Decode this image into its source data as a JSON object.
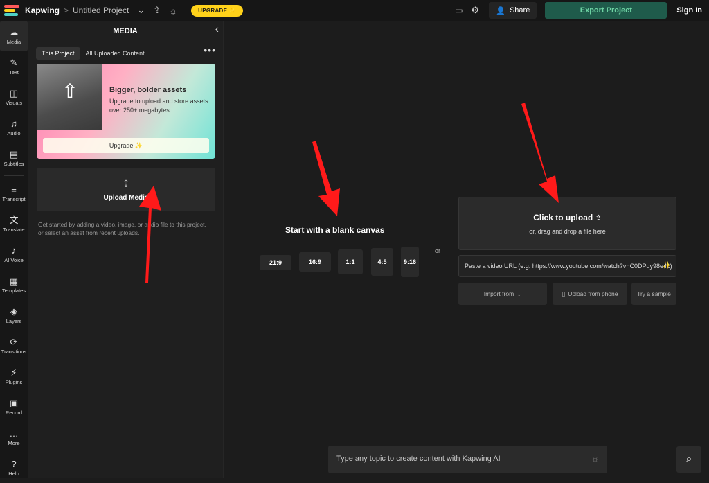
{
  "topbar": {
    "brand": "Kapwing",
    "separator": ">",
    "project_title": "Untitled Project",
    "upgrade_label": "UPGRADE ✨",
    "share_label": "Share",
    "export_label": "Export Project",
    "signin_label": "Sign In",
    "logo_colors": [
      "#ff5a5a",
      "#ffd21a",
      "#4fd1c5"
    ]
  },
  "rail": {
    "items": [
      {
        "label": "Media",
        "icon": "media-icon",
        "glyph": "☁"
      },
      {
        "label": "Text",
        "icon": "text-icon",
        "glyph": "✎"
      },
      {
        "label": "Visuals",
        "icon": "visuals-icon",
        "glyph": "◫"
      },
      {
        "label": "Audio",
        "icon": "audio-icon",
        "glyph": "♫"
      },
      {
        "label": "Subtitles",
        "icon": "subtitles-icon",
        "glyph": "▤"
      },
      {
        "label": "Transcript",
        "icon": "transcript-icon",
        "glyph": "≡"
      },
      {
        "label": "Translate",
        "icon": "translate-icon",
        "glyph": "文"
      },
      {
        "label": "AI Voice",
        "icon": "ai-voice-icon",
        "glyph": "♪"
      },
      {
        "label": "Templates",
        "icon": "templates-icon",
        "glyph": "▦"
      },
      {
        "label": "Layers",
        "icon": "layers-icon",
        "glyph": "◈"
      },
      {
        "label": "Transitions",
        "icon": "transitions-icon",
        "glyph": "⟳"
      },
      {
        "label": "Plugins",
        "icon": "plugins-icon",
        "glyph": "⚡"
      },
      {
        "label": "Record",
        "icon": "record-icon",
        "glyph": "▣"
      },
      {
        "label": "More",
        "icon": "more-icon",
        "glyph": "…"
      },
      {
        "label": "Help",
        "icon": "help-icon",
        "glyph": "?"
      }
    ]
  },
  "panel": {
    "title": "MEDIA",
    "tabs": [
      "This Project",
      "All Uploaded Content"
    ],
    "promo": {
      "heading": "Bigger, bolder assets",
      "body": "Upgrade to upload and store assets over 250+ megabytes",
      "button": "Upgrade ✨"
    },
    "upload_label": "Upload Media",
    "helper_text": "Get started by adding a video, image, or audio file to this project, or select an asset from recent uploads."
  },
  "main": {
    "blank_title": "Start with a blank canvas",
    "ratios": [
      "21:9",
      "16:9",
      "1:1",
      "4:5",
      "9:16"
    ],
    "or_label": "or",
    "drop_title": "Click to upload",
    "drop_sub": "or, drag and drop a file here",
    "url_placeholder": "Paste a video URL (e.g. https://www.youtube.com/watch?v=C0DPdy98e4c)",
    "import_label": "Import from",
    "phone_label": "Upload from phone",
    "sample_label": "Try a sample",
    "ai_placeholder": "Type any topic to create content with Kapwing AI"
  },
  "colors": {
    "accent_yellow": "#ffd21a",
    "export_bg": "#1f5b4b",
    "arrow_red": "#ff1a1a"
  }
}
